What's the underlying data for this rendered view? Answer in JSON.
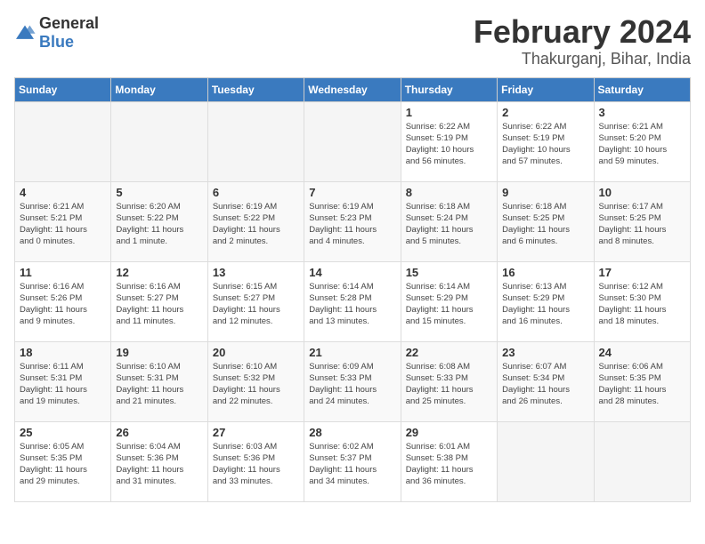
{
  "header": {
    "logo_general": "General",
    "logo_blue": "Blue",
    "month_year": "February 2024",
    "location": "Thakurganj, Bihar, India"
  },
  "columns": [
    "Sunday",
    "Monday",
    "Tuesday",
    "Wednesday",
    "Thursday",
    "Friday",
    "Saturday"
  ],
  "weeks": [
    [
      {
        "day": "",
        "info": ""
      },
      {
        "day": "",
        "info": ""
      },
      {
        "day": "",
        "info": ""
      },
      {
        "day": "",
        "info": ""
      },
      {
        "day": "1",
        "info": "Sunrise: 6:22 AM\nSunset: 5:19 PM\nDaylight: 10 hours\nand 56 minutes."
      },
      {
        "day": "2",
        "info": "Sunrise: 6:22 AM\nSunset: 5:19 PM\nDaylight: 10 hours\nand 57 minutes."
      },
      {
        "day": "3",
        "info": "Sunrise: 6:21 AM\nSunset: 5:20 PM\nDaylight: 10 hours\nand 59 minutes."
      }
    ],
    [
      {
        "day": "4",
        "info": "Sunrise: 6:21 AM\nSunset: 5:21 PM\nDaylight: 11 hours\nand 0 minutes."
      },
      {
        "day": "5",
        "info": "Sunrise: 6:20 AM\nSunset: 5:22 PM\nDaylight: 11 hours\nand 1 minute."
      },
      {
        "day": "6",
        "info": "Sunrise: 6:19 AM\nSunset: 5:22 PM\nDaylight: 11 hours\nand 2 minutes."
      },
      {
        "day": "7",
        "info": "Sunrise: 6:19 AM\nSunset: 5:23 PM\nDaylight: 11 hours\nand 4 minutes."
      },
      {
        "day": "8",
        "info": "Sunrise: 6:18 AM\nSunset: 5:24 PM\nDaylight: 11 hours\nand 5 minutes."
      },
      {
        "day": "9",
        "info": "Sunrise: 6:18 AM\nSunset: 5:25 PM\nDaylight: 11 hours\nand 6 minutes."
      },
      {
        "day": "10",
        "info": "Sunrise: 6:17 AM\nSunset: 5:25 PM\nDaylight: 11 hours\nand 8 minutes."
      }
    ],
    [
      {
        "day": "11",
        "info": "Sunrise: 6:16 AM\nSunset: 5:26 PM\nDaylight: 11 hours\nand 9 minutes."
      },
      {
        "day": "12",
        "info": "Sunrise: 6:16 AM\nSunset: 5:27 PM\nDaylight: 11 hours\nand 11 minutes."
      },
      {
        "day": "13",
        "info": "Sunrise: 6:15 AM\nSunset: 5:27 PM\nDaylight: 11 hours\nand 12 minutes."
      },
      {
        "day": "14",
        "info": "Sunrise: 6:14 AM\nSunset: 5:28 PM\nDaylight: 11 hours\nand 13 minutes."
      },
      {
        "day": "15",
        "info": "Sunrise: 6:14 AM\nSunset: 5:29 PM\nDaylight: 11 hours\nand 15 minutes."
      },
      {
        "day": "16",
        "info": "Sunrise: 6:13 AM\nSunset: 5:29 PM\nDaylight: 11 hours\nand 16 minutes."
      },
      {
        "day": "17",
        "info": "Sunrise: 6:12 AM\nSunset: 5:30 PM\nDaylight: 11 hours\nand 18 minutes."
      }
    ],
    [
      {
        "day": "18",
        "info": "Sunrise: 6:11 AM\nSunset: 5:31 PM\nDaylight: 11 hours\nand 19 minutes."
      },
      {
        "day": "19",
        "info": "Sunrise: 6:10 AM\nSunset: 5:31 PM\nDaylight: 11 hours\nand 21 minutes."
      },
      {
        "day": "20",
        "info": "Sunrise: 6:10 AM\nSunset: 5:32 PM\nDaylight: 11 hours\nand 22 minutes."
      },
      {
        "day": "21",
        "info": "Sunrise: 6:09 AM\nSunset: 5:33 PM\nDaylight: 11 hours\nand 24 minutes."
      },
      {
        "day": "22",
        "info": "Sunrise: 6:08 AM\nSunset: 5:33 PM\nDaylight: 11 hours\nand 25 minutes."
      },
      {
        "day": "23",
        "info": "Sunrise: 6:07 AM\nSunset: 5:34 PM\nDaylight: 11 hours\nand 26 minutes."
      },
      {
        "day": "24",
        "info": "Sunrise: 6:06 AM\nSunset: 5:35 PM\nDaylight: 11 hours\nand 28 minutes."
      }
    ],
    [
      {
        "day": "25",
        "info": "Sunrise: 6:05 AM\nSunset: 5:35 PM\nDaylight: 11 hours\nand 29 minutes."
      },
      {
        "day": "26",
        "info": "Sunrise: 6:04 AM\nSunset: 5:36 PM\nDaylight: 11 hours\nand 31 minutes."
      },
      {
        "day": "27",
        "info": "Sunrise: 6:03 AM\nSunset: 5:36 PM\nDaylight: 11 hours\nand 33 minutes."
      },
      {
        "day": "28",
        "info": "Sunrise: 6:02 AM\nSunset: 5:37 PM\nDaylight: 11 hours\nand 34 minutes."
      },
      {
        "day": "29",
        "info": "Sunrise: 6:01 AM\nSunset: 5:38 PM\nDaylight: 11 hours\nand 36 minutes."
      },
      {
        "day": "",
        "info": ""
      },
      {
        "day": "",
        "info": ""
      }
    ]
  ]
}
